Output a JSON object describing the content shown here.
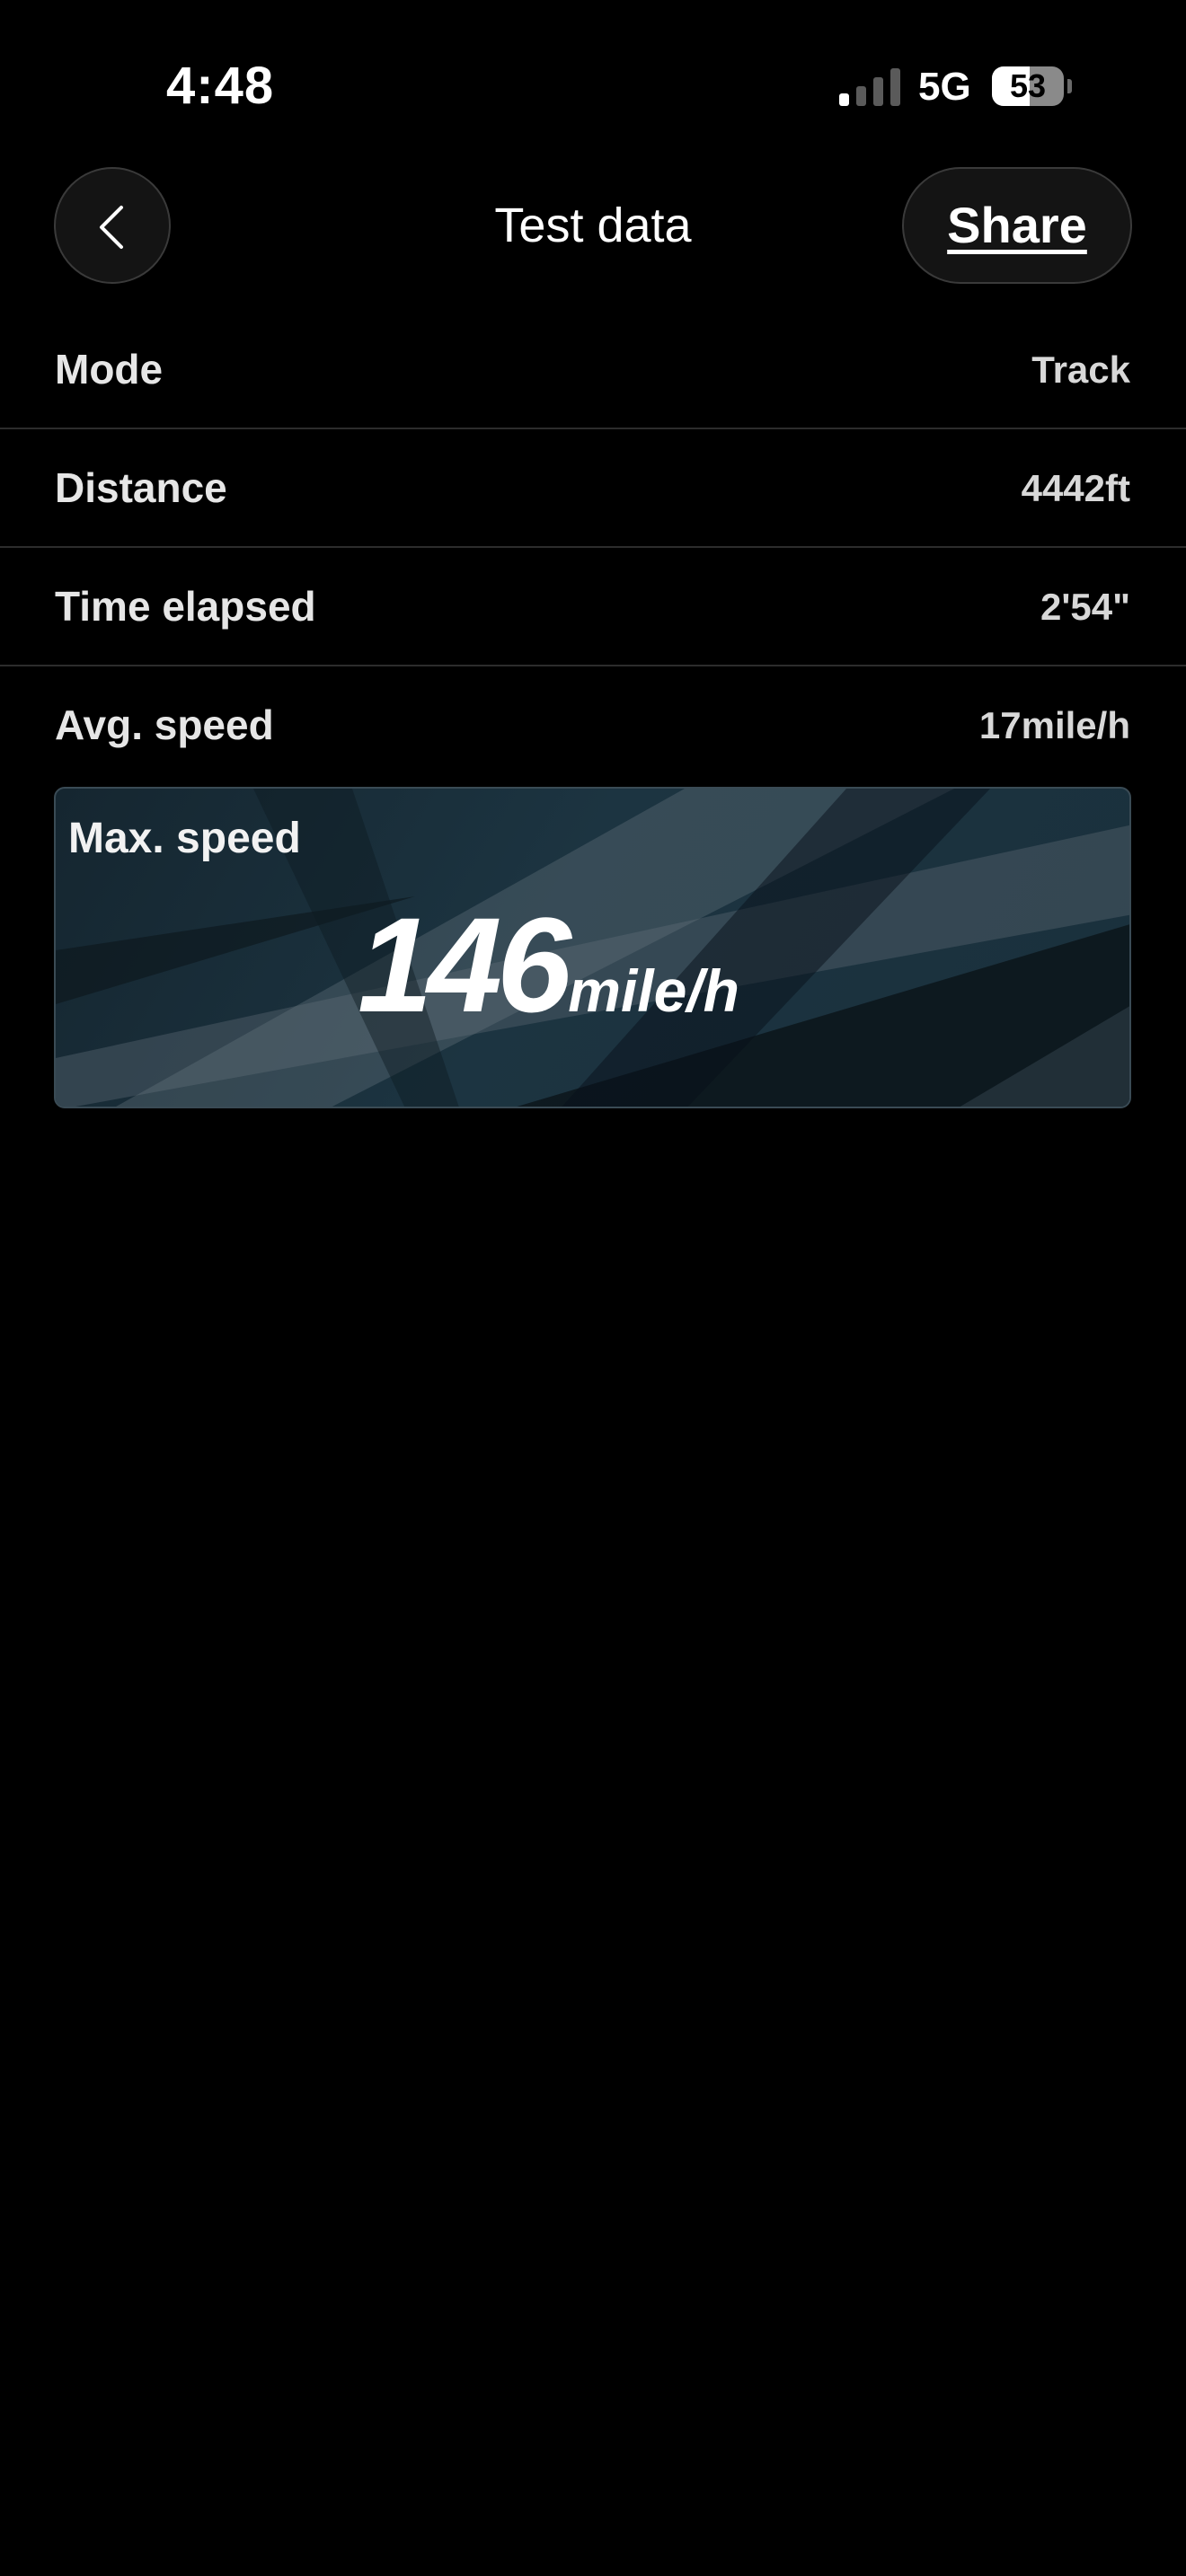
{
  "status_bar": {
    "time": "4:48",
    "network": "5G",
    "battery_level": "53",
    "battery_fraction": 0.53,
    "signal_bars_active": 1,
    "signal_bars_total": 4
  },
  "header": {
    "title": "Test data",
    "share_label": "Share",
    "back_icon": "chevron-left-icon"
  },
  "rows": [
    {
      "label": "Mode",
      "value": "Track"
    },
    {
      "label": "Distance",
      "value": "4442ft"
    },
    {
      "label": "Time elapsed",
      "value": "2'54\""
    },
    {
      "label": "Avg. speed",
      "value": "17mile/h"
    }
  ],
  "max_speed": {
    "label": "Max. speed",
    "value": "146",
    "unit": "mile/h"
  },
  "colors": {
    "background": "#000000",
    "divider": "#2c2c2c",
    "card_background": "#1c3441",
    "button_background": "#141414"
  }
}
